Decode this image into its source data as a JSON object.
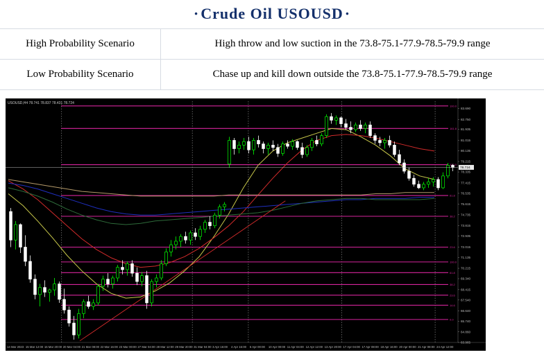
{
  "title": {
    "prefix": "·",
    "text": "Crude  Oil  USOUSD",
    "suffix": "·"
  },
  "scenarios": [
    {
      "label": "High Probability Scenario",
      "text": "High throw and low suction in the 73.8-75.1-77.9-78.5-79.9 range"
    },
    {
      "label": "Low Probability Scenario",
      "text": "Chase up and kill down outside the 73.8-75.1-77.9-78.5-79.9 range"
    }
  ],
  "colors": {
    "background": "#000000",
    "bull": "#00ff00",
    "bear": "#ffffff",
    "fib_line": "#d6249c",
    "grid": "#9a9a9a",
    "axis_text": "#bdbdbd",
    "title_blue": "#14306b"
  },
  "chart_data": {
    "type": "candlestick",
    "symbol_label": "USOUSD,H4  78.741 78.837 78.431 78.724",
    "ylim": [
      63.965,
      84.3
    ],
    "y_ticks": [
      83.69,
      82.75,
      81.935,
      81.015,
      80.135,
      79.215,
      78.335,
      77.415,
      76.535,
      75.615,
      74.735,
      73.815,
      72.935,
      72.015,
      71.135,
      70.215,
      69.34,
      68.415,
      67.54,
      66.64,
      65.74,
      64.86,
      63.965
    ],
    "current_price": 78.724,
    "current_price_label": "78.724",
    "x_labels": [
      "14 Mar 2023",
      "15 Mar 12:00",
      "16 Mar 20:00",
      "20 Mar 04:00",
      "21 Mar 08:00",
      "22 Mar 16:00",
      "23 Mar 00:00",
      "27 Mar 04:00",
      "28 Mar 12:00",
      "29 Mar 20:00",
      "31 Mar 04:00",
      "3 Apr 16:00",
      "4 Apr 16:00",
      "6 Apr 00:00",
      "10 Apr 00:00",
      "11 Apr 04:00",
      "12 Apr 12:00",
      "13 Apr 20:00",
      "17 Apr 04:00",
      "17 Apr 08:00",
      "18 Apr 16:00",
      "20 Apr 00:00",
      "21 Apr 08:00",
      "24 Apr 12:00"
    ],
    "vertical_separator_labels": [
      "20 Mar 04:00",
      "31 Mar 04:00",
      "6 Apr 00:00",
      "17 Apr 04:00",
      "24 Apr 12:00"
    ],
    "fib_levels": [
      {
        "price": 83.9,
        "label": "100.0"
      },
      {
        "price": 82.0,
        "label": "161.8"
      },
      {
        "price": 78.95,
        "label": "100.0"
      },
      {
        "price": 76.35,
        "label": "61.8"
      },
      {
        "price": 74.6,
        "label": "38.2"
      },
      {
        "price": 72.0,
        "label": "23.6"
      },
      {
        "price": 70.75,
        "label": "100.0"
      },
      {
        "price": 69.85,
        "label": "61.8"
      },
      {
        "price": 68.85,
        "label": "38.2"
      },
      {
        "price": 67.95,
        "label": "23.6"
      },
      {
        "price": 67.1,
        "label": "14.6"
      },
      {
        "price": 65.9,
        "label": "0.0"
      }
    ],
    "fib_label_colors": [
      "#d6249c",
      "#d6249c",
      "#d6249c",
      "#d6249c",
      "#d6249c",
      "#d6249c",
      "#d6249c",
      "#d6249c",
      "#d6249c",
      "#d6249c",
      "#d6249c",
      "#d6249c"
    ],
    "candles": [
      [
        75.0,
        75.3,
        72.0,
        72.6
      ],
      [
        72.6,
        74.2,
        71.8,
        73.9
      ],
      [
        73.9,
        74.0,
        71.5,
        72.0
      ],
      [
        72.0,
        73.0,
        70.4,
        70.8
      ],
      [
        70.8,
        71.3,
        69.0,
        69.3
      ],
      [
        69.3,
        69.7,
        67.6,
        68.0
      ],
      [
        68.0,
        68.9,
        67.0,
        68.6
      ],
      [
        68.6,
        69.2,
        67.8,
        68.2
      ],
      [
        68.2,
        68.5,
        67.4,
        68.4
      ],
      [
        68.4,
        69.4,
        67.9,
        68.9
      ],
      [
        68.9,
        69.1,
        67.3,
        67.6
      ],
      [
        67.6,
        68.5,
        66.4,
        66.7
      ],
      [
        66.7,
        67.0,
        65.3,
        65.6
      ],
      [
        65.6,
        66.2,
        64.2,
        64.6
      ],
      [
        64.6,
        66.8,
        64.3,
        66.4
      ],
      [
        66.4,
        67.6,
        66.0,
        67.4
      ],
      [
        67.4,
        67.9,
        66.8,
        67.0
      ],
      [
        67.0,
        67.6,
        66.7,
        67.3
      ],
      [
        67.3,
        68.9,
        67.1,
        68.7
      ],
      [
        68.7,
        69.6,
        68.3,
        69.3
      ],
      [
        69.3,
        69.8,
        68.6,
        68.9
      ],
      [
        68.9,
        69.6,
        68.5,
        69.4
      ],
      [
        69.4,
        70.5,
        69.1,
        70.3
      ],
      [
        70.3,
        70.9,
        69.7,
        70.1
      ],
      [
        70.1,
        70.8,
        69.6,
        70.6
      ],
      [
        70.6,
        70.9,
        69.5,
        69.8
      ],
      [
        69.8,
        70.3,
        68.8,
        69.1
      ],
      [
        69.1,
        69.9,
        68.7,
        69.6
      ],
      [
        69.6,
        70.0,
        66.8,
        67.3
      ],
      [
        67.3,
        69.3,
        67.0,
        69.1
      ],
      [
        69.1,
        69.7,
        68.6,
        69.4
      ],
      [
        69.4,
        70.9,
        69.2,
        70.6
      ],
      [
        70.6,
        71.9,
        70.4,
        71.6
      ],
      [
        71.6,
        72.6,
        71.2,
        72.2
      ],
      [
        72.2,
        72.9,
        71.8,
        72.5
      ],
      [
        72.5,
        73.1,
        72.0,
        72.9
      ],
      [
        72.9,
        73.3,
        72.3,
        72.6
      ],
      [
        72.6,
        73.4,
        72.2,
        73.2
      ],
      [
        73.2,
        73.6,
        72.6,
        72.9
      ],
      [
        72.9,
        73.8,
        72.6,
        73.5
      ],
      [
        73.5,
        74.3,
        73.2,
        74.1
      ],
      [
        74.1,
        74.6,
        73.5,
        73.8
      ],
      [
        73.8,
        74.9,
        73.6,
        74.7
      ],
      [
        74.7,
        75.6,
        74.4,
        75.4
      ],
      [
        75.4,
        75.8,
        75.0,
        75.6
      ],
      [
        79.0,
        81.3,
        78.7,
        81.0
      ],
      [
        81.0,
        81.2,
        79.8,
        80.3
      ],
      [
        80.3,
        80.9,
        79.9,
        80.6
      ],
      [
        80.6,
        81.2,
        80.2,
        80.9
      ],
      [
        80.9,
        81.3,
        79.9,
        80.2
      ],
      [
        80.2,
        81.2,
        79.8,
        81.0
      ],
      [
        81.0,
        81.4,
        80.4,
        80.7
      ],
      [
        80.7,
        80.9,
        79.9,
        80.3
      ],
      [
        80.3,
        80.8,
        79.8,
        80.6
      ],
      [
        80.6,
        81.0,
        80.1,
        80.4
      ],
      [
        80.4,
        80.7,
        79.6,
        79.9
      ],
      [
        79.9,
        80.9,
        79.7,
        80.7
      ],
      [
        80.7,
        81.0,
        80.3,
        80.5
      ],
      [
        80.5,
        81.1,
        80.2,
        80.9
      ],
      [
        80.9,
        81.0,
        80.2,
        80.4
      ],
      [
        80.4,
        80.8,
        79.5,
        79.8
      ],
      [
        79.8,
        80.6,
        79.6,
        80.4
      ],
      [
        80.4,
        81.2,
        80.1,
        81.0
      ],
      [
        81.0,
        81.4,
        80.5,
        80.7
      ],
      [
        80.7,
        81.6,
        80.5,
        81.4
      ],
      [
        81.4,
        83.2,
        81.2,
        83.0
      ],
      [
        83.0,
        83.3,
        82.4,
        82.7
      ],
      [
        82.7,
        83.1,
        82.3,
        82.9
      ],
      [
        82.9,
        83.0,
        82.1,
        82.4
      ],
      [
        82.4,
        82.8,
        81.9,
        82.1
      ],
      [
        82.1,
        82.6,
        81.6,
        81.9
      ],
      [
        81.9,
        82.5,
        81.7,
        82.3
      ],
      [
        82.3,
        82.7,
        81.8,
        82.0
      ],
      [
        82.0,
        82.5,
        81.6,
        82.3
      ],
      [
        82.3,
        82.6,
        81.2,
        81.4
      ],
      [
        81.4,
        81.6,
        80.7,
        81.0
      ],
      [
        81.0,
        81.3,
        80.5,
        80.8
      ],
      [
        80.8,
        81.2,
        80.3,
        81.0
      ],
      [
        81.0,
        81.4,
        80.4,
        80.6
      ],
      [
        80.6,
        80.9,
        79.6,
        79.8
      ],
      [
        79.8,
        80.2,
        78.9,
        79.1
      ],
      [
        79.1,
        79.4,
        78.2,
        78.4
      ],
      [
        78.4,
        78.7,
        77.6,
        77.8
      ],
      [
        77.8,
        78.1,
        77.1,
        77.3
      ],
      [
        77.3,
        77.6,
        76.9,
        77.0
      ],
      [
        77.0,
        77.5,
        76.8,
        77.3
      ],
      [
        77.3,
        77.8,
        77.0,
        77.5
      ],
      [
        77.5,
        77.9,
        77.1,
        77.7
      ],
      [
        77.7,
        77.9,
        76.8,
        77.0
      ],
      [
        77.0,
        78.3,
        76.9,
        78.0
      ],
      [
        78.0,
        79.1,
        77.8,
        78.9
      ],
      [
        78.9,
        79.0,
        78.4,
        78.72
      ]
    ],
    "moving_averages": [
      {
        "color": "#c8c84a",
        "values": [
          76.5,
          75.5,
          74.2,
          72.8,
          71.3,
          70.0,
          68.9,
          68.1,
          67.7,
          67.8,
          68.3,
          69.0,
          70.0,
          71.2,
          72.9,
          74.8,
          77.0,
          78.9,
          80.1,
          80.8,
          81.2,
          81.6,
          82.0,
          81.9,
          81.3,
          80.6,
          79.7,
          78.6,
          78.0,
          77.7
        ]
      },
      {
        "color": "#d22b2b",
        "values": [
          77.6,
          76.9,
          76.0,
          74.9,
          73.8,
          72.7,
          71.8,
          71.1,
          70.6,
          70.3,
          70.4,
          70.7,
          71.2,
          71.9,
          72.8,
          73.8,
          75.0,
          76.4,
          77.8,
          79.1,
          80.2,
          81.0,
          81.4,
          81.5,
          81.4,
          81.2,
          80.9,
          80.6,
          80.3,
          80.1
        ]
      },
      {
        "color": "#b59a6a",
        "values": [
          77.7,
          77.5,
          77.3,
          77.1,
          76.9,
          76.7,
          76.6,
          76.5,
          76.4,
          76.3,
          76.3,
          76.3,
          76.3,
          76.3,
          76.3,
          76.4,
          76.4,
          76.4,
          76.4,
          76.4,
          76.4,
          76.4,
          76.4,
          76.4,
          76.4,
          76.5,
          76.5,
          76.6,
          76.6,
          76.6
        ]
      },
      {
        "color": "#1f2fbf",
        "values": [
          77.4,
          77.2,
          76.9,
          76.5,
          76.1,
          75.7,
          75.3,
          75.0,
          74.8,
          74.7,
          74.7,
          74.8,
          74.9,
          75.0,
          75.1,
          75.2,
          75.3,
          75.4,
          75.5,
          75.6,
          75.7,
          75.8,
          75.9,
          76.0,
          76.0,
          76.1,
          76.1,
          76.1,
          76.2,
          76.2
        ]
      },
      {
        "color": "#2e6b3a",
        "values": [
          77.0,
          76.7,
          76.3,
          75.8,
          75.2,
          74.7,
          74.3,
          74.0,
          73.9,
          74.0,
          74.2,
          74.3,
          74.4,
          74.5,
          74.6,
          74.7,
          74.8,
          74.9,
          75.1,
          75.4,
          75.7,
          75.9,
          76.0,
          76.1,
          76.1,
          76.0,
          76.0,
          76.0,
          76.0,
          76.1
        ]
      }
    ],
    "trendlines": [
      {
        "color": "#d22b2b",
        "from": [
          0.16,
          64.1
        ],
        "to": [
          0.62,
          75.9
        ]
      }
    ]
  }
}
